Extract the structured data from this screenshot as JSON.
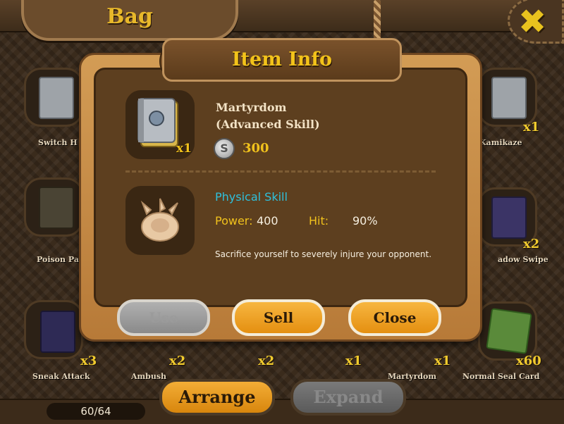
{
  "header": {
    "title": "Bag",
    "close_icon": "x-close-icon"
  },
  "background_items": {
    "top_row_labels": [
      "Switch H",
      "Kamikaze"
    ],
    "mid_row_labels": [
      "Poison Pa",
      "adow Swipe"
    ],
    "bottom_row_labels": [
      "Sneak Attack",
      "Ambush",
      "Martyrdom",
      "Normal Seal Card"
    ],
    "quantities": [
      "x1",
      "x2",
      "x3",
      "x2",
      "x2",
      "x1",
      "x1",
      "x60"
    ]
  },
  "modal": {
    "title": "Item Info",
    "item": {
      "name": "Martyrdom",
      "subtitle": "(Advanced Skill)",
      "quantity": "x1",
      "price": "300",
      "coin_symbol": "S"
    },
    "skill": {
      "type": "Physical Skill",
      "power_label": "Power:",
      "power_value": "400",
      "hit_label": "Hit:",
      "hit_value": "90%",
      "description": "Sacrifice yourself to severely injure your opponent."
    },
    "buttons": {
      "use": "Use",
      "sell": "Sell",
      "close": "Close"
    }
  },
  "footer": {
    "capacity": "60/64",
    "arrange": "Arrange",
    "expand": "Expand"
  },
  "colors": {
    "accent_gold": "#f1c21c",
    "skill_cyan": "#2ec0dc",
    "button_orange": "#e48f10"
  }
}
